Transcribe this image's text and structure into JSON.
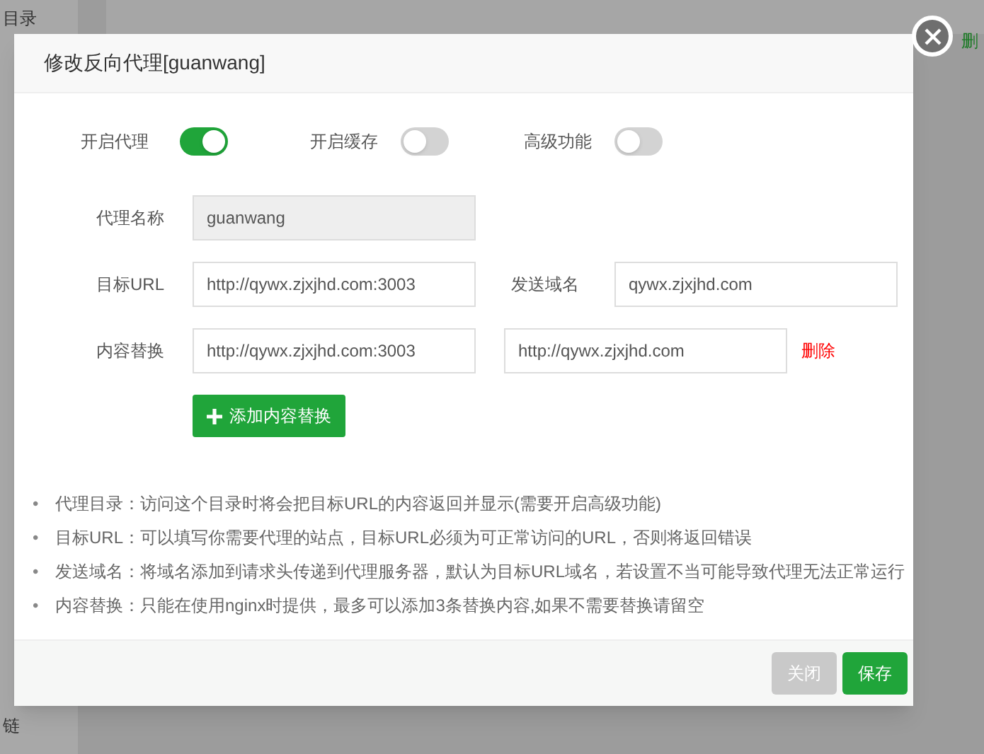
{
  "background": {
    "sidebar_items": [
      "目录",
      "链"
    ],
    "row_action": "删"
  },
  "dialog": {
    "title": "修改反向代理[guanwang]",
    "toggles": [
      {
        "label": "开启代理",
        "on": true
      },
      {
        "label": "开启缓存",
        "on": false
      },
      {
        "label": "高级功能",
        "on": false
      }
    ],
    "proxy_name": {
      "label": "代理名称",
      "value": "guanwang",
      "disabled": true
    },
    "target_url": {
      "label": "目标URL",
      "value": "http://qywx.zjxjhd.com:3003"
    },
    "send_domain": {
      "label": "发送域名",
      "value": "qywx.zjxjhd.com"
    },
    "content_replace": {
      "label": "内容替换",
      "from": "http://qywx.zjxjhd.com:3003",
      "to": "http://qywx.zjxjhd.com",
      "delete": "删除"
    },
    "add_button": "添加内容替换",
    "notes": [
      {
        "bullet": "•",
        "text": "代理目录：访问这个目录时将会把目标URL的内容返回并显示(需要开启高级功能)"
      },
      {
        "bullet": "•",
        "text": "目标URL：可以填写你需要代理的站点，目标URL必须为可正常访问的URL，否则将返回错误"
      },
      {
        "bullet": "•",
        "text": "发送域名：将域名添加到请求头传递到代理服务器，默认为目标URL域名，若设置不当可能导致代理无法正常运行"
      },
      {
        "bullet": "•",
        "text": "内容替换：只能在使用nginx时提供，最多可以添加3条替换内容,如果不需要替换请留空"
      }
    ],
    "buttons": [
      {
        "label": "关闭",
        "kind": "secondary"
      },
      {
        "label": "保存",
        "kind": "primary"
      }
    ]
  }
}
